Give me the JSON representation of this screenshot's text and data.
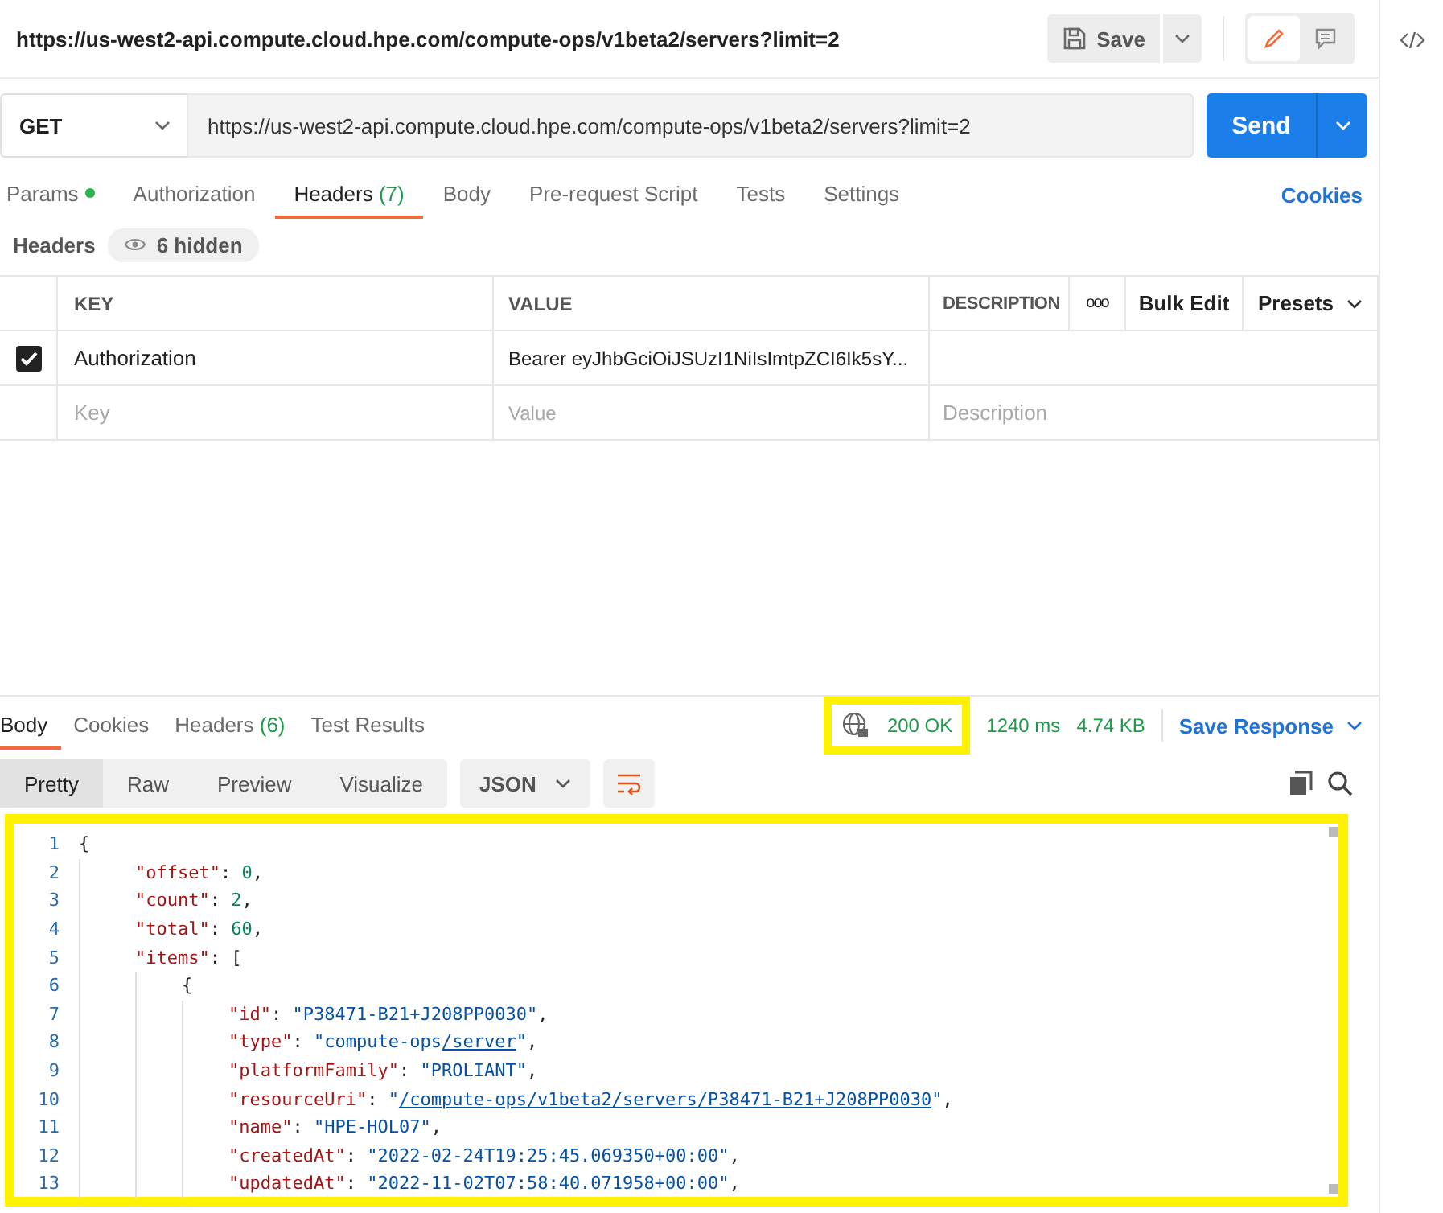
{
  "request": {
    "title": "https://us-west2-api.compute.cloud.hpe.com/compute-ops/v1beta2/servers?limit=2",
    "save_label": "Save",
    "method": "GET",
    "url": "https://us-west2-api.compute.cloud.hpe.com/compute-ops/v1beta2/servers?limit=2",
    "send_label": "Send"
  },
  "mode_buttons": [
    {
      "kind": "edit",
      "selected": true
    },
    {
      "kind": "comments",
      "selected": false
    }
  ],
  "request_tabs": [
    {
      "label": "Params",
      "dot": true,
      "selected": false
    },
    {
      "label": "Authorization",
      "dot": false,
      "selected": false
    },
    {
      "label": "Headers",
      "count": "(7)",
      "dot": false,
      "selected": true
    },
    {
      "label": "Body",
      "dot": false,
      "selected": false
    },
    {
      "label": "Pre-request Script",
      "dot": false,
      "selected": false
    },
    {
      "label": "Tests",
      "dot": false,
      "selected": false
    },
    {
      "label": "Settings",
      "dot": false,
      "selected": false
    }
  ],
  "cookies_link": "Cookies",
  "headers_section": {
    "title": "Headers",
    "hidden_label": "6 hidden"
  },
  "headers_table": {
    "columns": [
      "KEY",
      "VALUE",
      "DESCRIPTION"
    ],
    "more": "ooo",
    "bulk_edit": "Bulk Edit",
    "presets": "Presets",
    "rows": [
      {
        "checked": true,
        "key": "Authorization",
        "value": "Bearer eyJhbGciOiJSUzI1NiIsImtpZCI6Ik5sY..."
      }
    ],
    "placeholder": {
      "key": "Key",
      "value": "Value",
      "description": "Description"
    }
  },
  "response_tabs": [
    {
      "label": "Body",
      "selected": true
    },
    {
      "label": "Cookies",
      "selected": false
    },
    {
      "label": "Headers",
      "count": "(6)",
      "selected": false
    },
    {
      "label": "Test Results",
      "selected": false
    }
  ],
  "response_status": {
    "status": "200 OK",
    "time": "1240 ms",
    "size": "4.74 KB",
    "save_response": "Save Response"
  },
  "view_modes": [
    {
      "label": "Pretty",
      "selected": true
    },
    {
      "label": "Raw",
      "selected": false
    },
    {
      "label": "Preview",
      "selected": false
    },
    {
      "label": "Visualize",
      "selected": false
    }
  ],
  "format": "JSON",
  "code_lines": [
    {
      "number": "1",
      "kind": "root",
      "parts": [
        {
          "kind": "punct",
          "text": "{"
        }
      ]
    },
    {
      "number": "2",
      "kind": "member",
      "parts": [
        {
          "kind": "key",
          "text": "\"offset\""
        },
        {
          "kind": "punct",
          "text": ": "
        },
        {
          "kind": "number",
          "text": "0"
        },
        {
          "kind": "punct",
          "text": ","
        }
      ]
    },
    {
      "number": "3",
      "kind": "member",
      "parts": [
        {
          "kind": "key",
          "text": "\"count\""
        },
        {
          "kind": "punct",
          "text": ": "
        },
        {
          "kind": "number",
          "text": "2"
        },
        {
          "kind": "punct",
          "text": ","
        }
      ]
    },
    {
      "number": "4",
      "kind": "member",
      "parts": [
        {
          "kind": "key",
          "text": "\"total\""
        },
        {
          "kind": "punct",
          "text": ": "
        },
        {
          "kind": "number",
          "text": "60"
        },
        {
          "kind": "punct",
          "text": ","
        }
      ]
    },
    {
      "number": "5",
      "kind": "member",
      "parts": [
        {
          "kind": "key",
          "text": "\"items\""
        },
        {
          "kind": "punct",
          "text": ": ["
        }
      ]
    },
    {
      "number": "6",
      "kind": "element",
      "parts": [
        {
          "kind": "punct",
          "text": "{"
        }
      ]
    },
    {
      "number": "7",
      "kind": "field",
      "parts": [
        {
          "kind": "key",
          "text": "\"id\""
        },
        {
          "kind": "punct",
          "text": ": "
        },
        {
          "kind": "string",
          "text": "\"P38471-B21+J208PP0030\""
        },
        {
          "kind": "punct",
          "text": ","
        }
      ]
    },
    {
      "number": "8",
      "kind": "field",
      "parts": [
        {
          "kind": "key",
          "text": "\"type\""
        },
        {
          "kind": "punct",
          "text": ": "
        },
        {
          "kind": "string",
          "text": "\"compute-ops"
        },
        {
          "kind": "link",
          "text": "/server"
        },
        {
          "kind": "string",
          "text": "\""
        },
        {
          "kind": "punct",
          "text": ","
        }
      ]
    },
    {
      "number": "9",
      "kind": "field",
      "parts": [
        {
          "kind": "key",
          "text": "\"platformFamily\""
        },
        {
          "kind": "punct",
          "text": ": "
        },
        {
          "kind": "string",
          "text": "\"PROLIANT\""
        },
        {
          "kind": "punct",
          "text": ","
        }
      ]
    },
    {
      "number": "10",
      "kind": "field",
      "parts": [
        {
          "kind": "key",
          "text": "\"resourceUri\""
        },
        {
          "kind": "punct",
          "text": ": "
        },
        {
          "kind": "string",
          "text": "\""
        },
        {
          "kind": "link",
          "text": "/compute-ops/v1beta2/servers/P38471-B21+J208PP0030"
        },
        {
          "kind": "string",
          "text": "\""
        },
        {
          "kind": "punct",
          "text": ","
        }
      ]
    },
    {
      "number": "11",
      "kind": "field",
      "parts": [
        {
          "kind": "key",
          "text": "\"name\""
        },
        {
          "kind": "punct",
          "text": ": "
        },
        {
          "kind": "string",
          "text": "\"HPE-HOL07\""
        },
        {
          "kind": "punct",
          "text": ","
        }
      ]
    },
    {
      "number": "12",
      "kind": "field",
      "parts": [
        {
          "kind": "key",
          "text": "\"createdAt\""
        },
        {
          "kind": "punct",
          "text": ": "
        },
        {
          "kind": "string",
          "text": "\"2022-02-24T19:25:45.069350+00:00\""
        },
        {
          "kind": "punct",
          "text": ","
        }
      ]
    },
    {
      "number": "13",
      "kind": "field",
      "parts": [
        {
          "kind": "key",
          "text": "\"updatedAt\""
        },
        {
          "kind": "punct",
          "text": ": "
        },
        {
          "kind": "string",
          "text": "\"2022-11-02T07:58:40.071958+00:00\""
        },
        {
          "kind": "punct",
          "text": ","
        }
      ]
    }
  ]
}
